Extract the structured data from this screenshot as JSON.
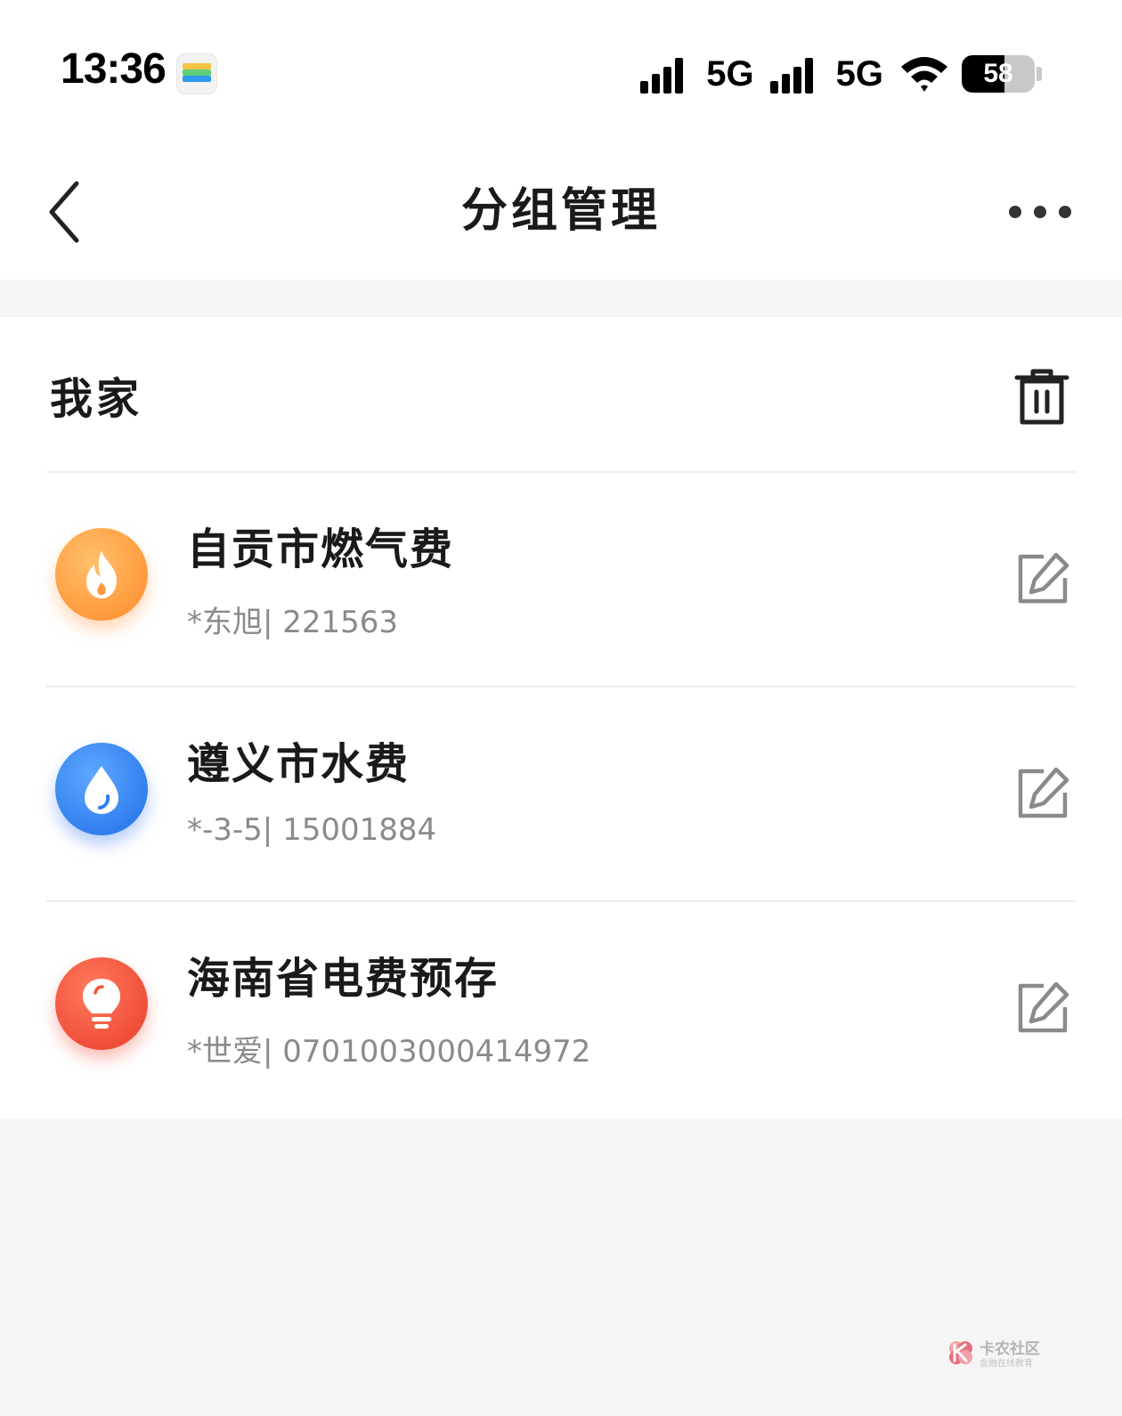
{
  "status_bar": {
    "time": "13:36",
    "network_1": "5G",
    "network_2": "5G",
    "battery_percent": 58
  },
  "nav": {
    "title": "分组管理"
  },
  "group": {
    "name": "我家",
    "items": [
      {
        "title": "自贡市燃气费",
        "subtitle": "*东旭| 221563",
        "icon": "flame-icon",
        "color": "#ffa24a"
      },
      {
        "title": "遵义市水费",
        "subtitle": "*-3-5| 15001884",
        "icon": "water-drop-icon",
        "color": "#2f7ef5"
      },
      {
        "title": "海南省电费预存",
        "subtitle": "*世爱| 0701003000414972",
        "icon": "light-bulb-icon",
        "color": "#f2543a"
      }
    ]
  },
  "watermark": {
    "name": "卡农社区",
    "slogan": "金融在线教育"
  },
  "colors": {
    "page_background": "#f5f5f5",
    "card_background": "#ffffff",
    "primary_text": "#1a1a1a",
    "secondary_text": "#8a8a8a"
  }
}
